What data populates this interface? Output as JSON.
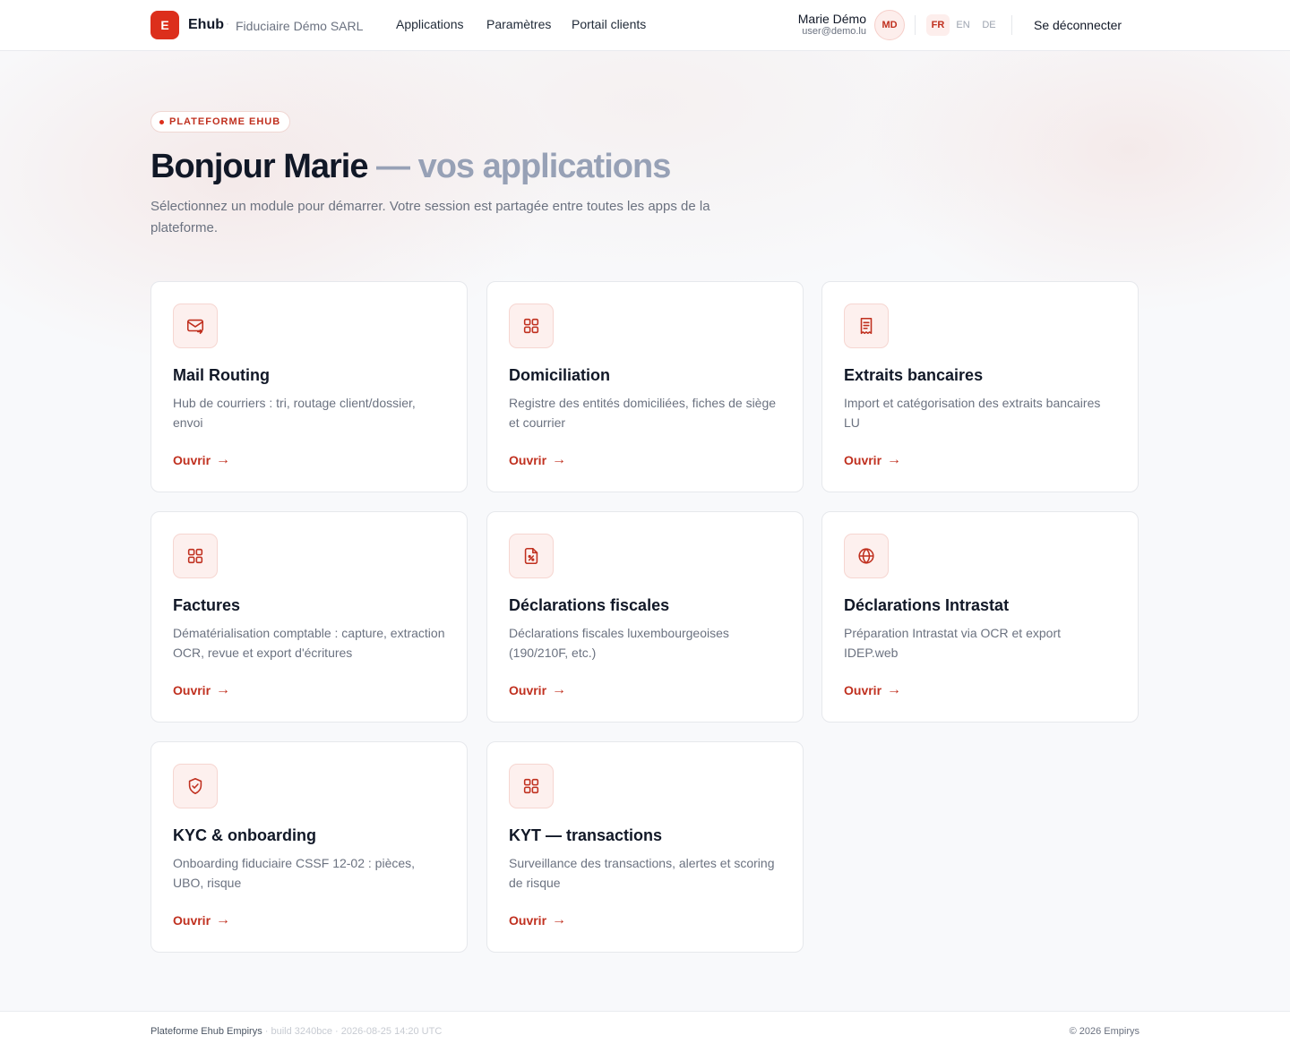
{
  "header": {
    "logo_letter": "E",
    "brand": "Ehub",
    "separator": "·",
    "organization": "Fiduciaire Démo SARL",
    "nav": [
      "Applications",
      "Paramètres",
      "Portail clients"
    ],
    "user": {
      "name": "Marie Démo",
      "email": "user@demo.lu",
      "initials": "MD"
    },
    "languages": [
      {
        "code": "FR",
        "active": true
      },
      {
        "code": "EN",
        "active": false
      },
      {
        "code": "DE",
        "active": false
      }
    ],
    "logout_label": "Se déconnecter"
  },
  "hero": {
    "badge": "PLATEFORME EHUB",
    "title_strong": "Bonjour Marie",
    "title_light": " — vos applications",
    "subtitle": "Sélectionnez un module pour démarrer. Votre session est partagée entre toutes les apps de la plateforme."
  },
  "cards": [
    {
      "icon": "mail-icon",
      "title": "Mail Routing",
      "description": "Hub de courriers : tri, routage client/dossier, envoi",
      "link": "Ouvrir"
    },
    {
      "icon": "grid-icon",
      "title": "Domiciliation",
      "description": "Registre des entités domiciliées, fiches de siège et courrier",
      "link": "Ouvrir"
    },
    {
      "icon": "receipt-icon",
      "title": "Extraits bancaires",
      "description": "Import et catégorisation des extraits bancaires LU",
      "link": "Ouvrir"
    },
    {
      "icon": "grid-icon",
      "title": "Factures",
      "description": "Dématérialisation comptable : capture, extraction OCR, revue et export d'écritures",
      "link": "Ouvrir"
    },
    {
      "icon": "tax-document-icon",
      "title": "Déclarations fiscales",
      "description": "Déclarations fiscales luxembourgeoises (190/210F, etc.)",
      "link": "Ouvrir"
    },
    {
      "icon": "globe-icon",
      "title": "Déclarations Intrastat",
      "description": "Préparation Intrastat via OCR et export IDEP.web",
      "link": "Ouvrir"
    },
    {
      "icon": "shield-check-icon",
      "title": "KYC & onboarding",
      "description": "Onboarding fiduciaire CSSF 12-02 : pièces, UBO, risque",
      "link": "Ouvrir"
    },
    {
      "icon": "grid-icon",
      "title": "KYT — transactions",
      "description": "Surveillance des transactions, alertes et scoring de risque",
      "link": "Ouvrir"
    }
  ],
  "footer": {
    "product": "Plateforme Ehub Empirys",
    "build": " · build 3240bce · 2026-08-25 14:20 UTC",
    "copyright": "© 2026 Empirys"
  },
  "colors": {
    "accent": "#dc2f1c",
    "accent_text": "#c0301f",
    "icon_bg": "#fdf0ee"
  }
}
